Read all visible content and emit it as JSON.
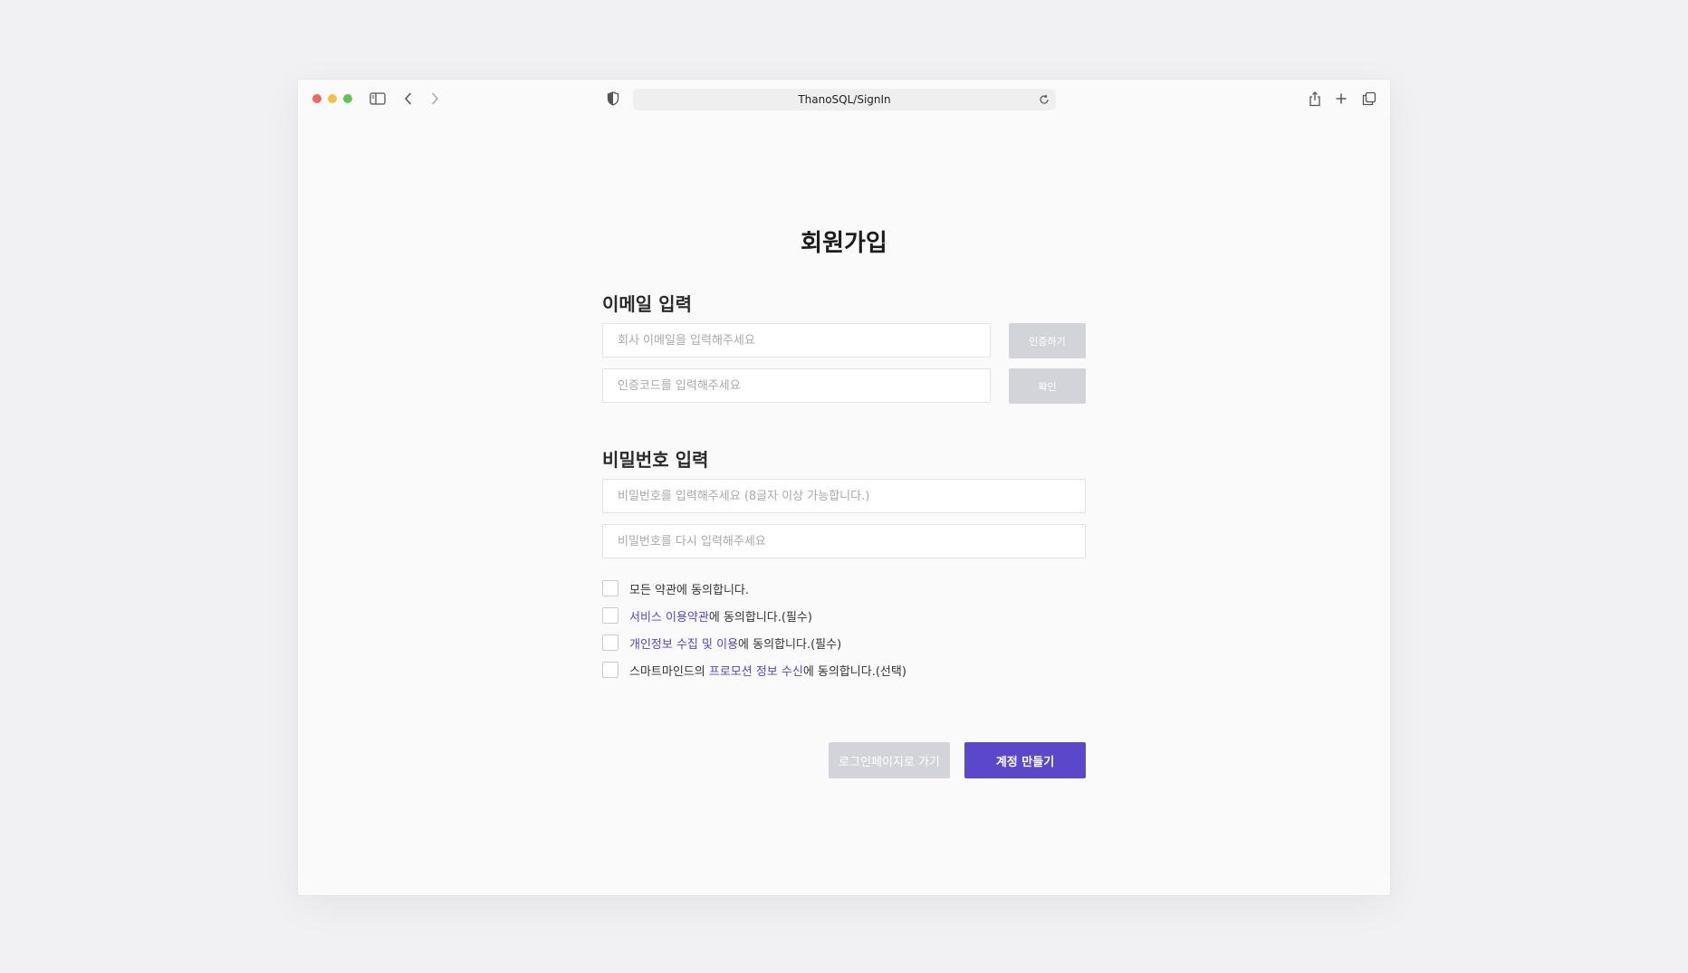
{
  "browser": {
    "url": "ThanoSQL/SignIn",
    "icons": {
      "close": "close-window-icon",
      "minimize": "minimize-window-icon",
      "maximize": "maximize-window-icon",
      "sidebar": "sidebar-icon",
      "back": "chevron-left-icon",
      "forward": "chevron-right-icon",
      "privacy": "shield-icon",
      "reload": "reload-icon",
      "share": "share-icon",
      "new_tab": "plus-icon",
      "tabs": "tabs-overview-icon"
    },
    "colors": {
      "close": "#ee6a5e",
      "minimize": "#f5bf4f",
      "maximize": "#61c454"
    }
  },
  "page": {
    "title": "회원가입",
    "email_section": {
      "heading": "이메일 입력",
      "email_placeholder": "회사 이메일을 입력해주세요",
      "email_value": "",
      "verify_button": "인증하기",
      "code_placeholder": "인증코드를 입력해주세요",
      "code_value": "",
      "confirm_button": "확인"
    },
    "password_section": {
      "heading": "비밀번호 입력",
      "password_placeholder": "비밀번호를 입력해주세요 (8글자 이상 가능합니다.)",
      "password_value": "",
      "confirm_placeholder": "비밀번호를 다시 입력해주세요",
      "confirm_value": ""
    },
    "agreements": {
      "all": {
        "text": "모든 약관에 동의합니다.",
        "checked": false
      },
      "service": {
        "link": "서비스 이용약관",
        "suffix": "에 동의합니다.(필수)",
        "checked": false
      },
      "privacy": {
        "link": "개인정보 수집 및 이용",
        "suffix": "에 동의합니다.(필수)",
        "checked": false
      },
      "promo": {
        "prefix": "스마트마인드의 ",
        "link": "프로모션 정보 수신",
        "suffix": "에 동의합니다.(선택)",
        "checked": false
      }
    },
    "buttons": {
      "back_to_login": "로그인페이지로 가기",
      "create_account": "계정 만들기"
    },
    "colors": {
      "accent": "#5b47c9",
      "link": "#5946c9",
      "disabled_button": "#d2d4da"
    }
  }
}
